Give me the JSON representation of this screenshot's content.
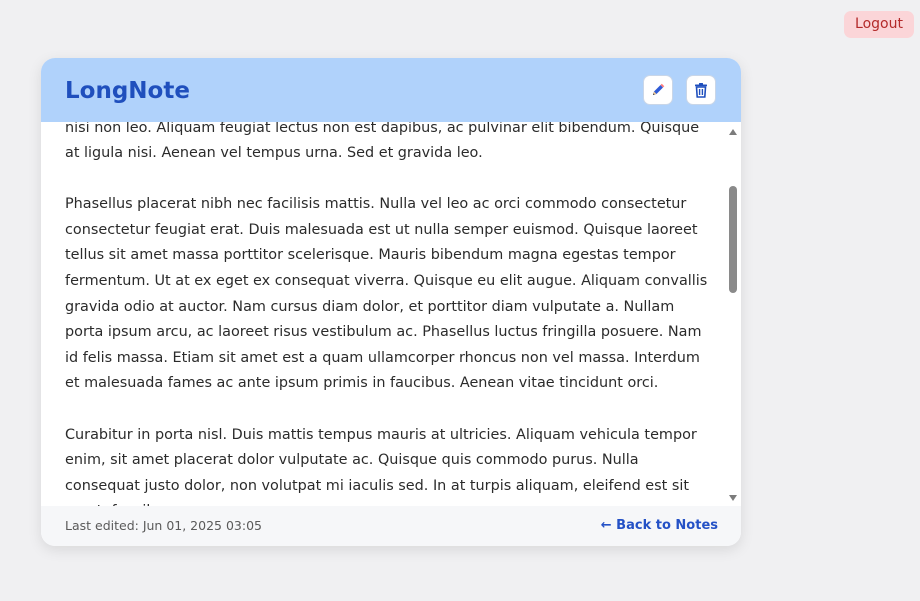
{
  "header": {
    "logout_label": "Logout"
  },
  "note": {
    "title": "LongNote",
    "paragraphs": [
      "nisi non leo. Aliquam feugiat lectus non est dapibus, ac pulvinar elit bibendum. Quisque at ligula nisi. Aenean vel tempus urna. Sed et gravida leo.",
      "Phasellus placerat nibh nec facilisis mattis. Nulla vel leo ac orci commodo consectetur consectetur feugiat erat. Duis malesuada est ut nulla semper euismod. Quisque laoreet tellus sit amet massa porttitor scelerisque. Mauris bibendum magna egestas tempor fermentum. Ut at ex eget ex consequat viverra. Quisque eu elit augue. Aliquam convallis gravida odio at auctor. Nam cursus diam dolor, et porttitor diam vulputate a. Nullam porta ipsum arcu, ac laoreet risus vestibulum ac. Phasellus luctus fringilla posuere. Nam id felis massa. Etiam sit amet est a quam ullamcorper rhoncus non vel massa. Interdum et malesuada fames ac ante ipsum primis in faucibus. Aenean vitae tincidunt orci.",
      "Curabitur in porta nisl. Duis mattis tempus mauris at ultricies. Aliquam vehicula tempor enim, sit amet placerat dolor vulputate ac. Quisque quis commodo purus. Nulla consequat justo dolor, non volutpat mi iaculis sed. In at turpis aliquam, eleifend est sit amet, faucibus"
    ],
    "last_edited": "Last edited: Jun 01, 2025 03:05",
    "back_link": "← Back to Notes"
  },
  "icons": {
    "edit": "pencil-icon",
    "delete": "trash-icon"
  },
  "colors": {
    "header_bg": "#b0d2fb",
    "title": "#1f4fbd",
    "link": "#2451c6",
    "logout_bg": "#fbd5d8",
    "logout_text": "#b32a2a",
    "page_bg": "#f0f0f2"
  }
}
